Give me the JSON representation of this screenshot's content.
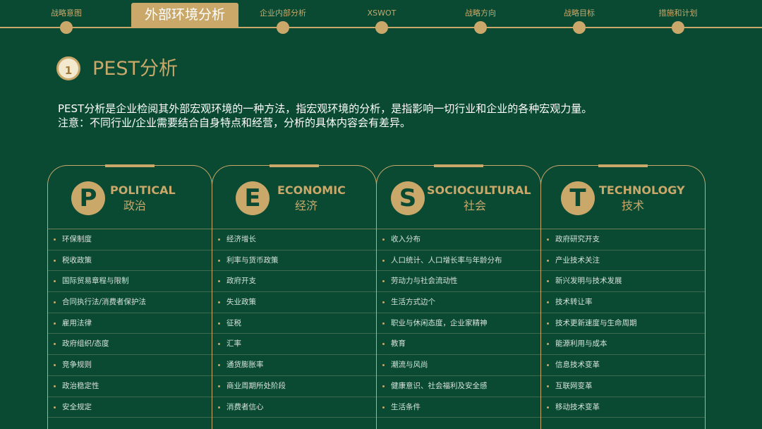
{
  "nav": {
    "items": [
      {
        "label": "战略意图",
        "active": false
      },
      {
        "label": "外部环境分析",
        "active": true
      },
      {
        "label": "企业内部分析",
        "active": false
      },
      {
        "label": "XSWOT",
        "active": false
      },
      {
        "label": "战略方向",
        "active": false
      },
      {
        "label": "战略目标",
        "active": false
      },
      {
        "label": "措施和计划",
        "active": false
      }
    ]
  },
  "section": {
    "number": "1",
    "title": "PEST分析"
  },
  "intro": {
    "line1": "PEST分析是企业检阅其外部宏观环境的一种方法，指宏观环境的分析，是指影响一切行业和企业的各种宏观力量。",
    "line2": "注意：不同行业/企业需要结合自身特点和经营，分析的具体内容会有差异。"
  },
  "cards": [
    {
      "letter": "P",
      "title_en": "POLITICAL",
      "title_zh": "政治",
      "items": [
        "环保制度",
        "税收政策",
        "国际贸易章程与限制",
        "合同执行法/消费者保护法",
        "雇用法律",
        "政府组织/态度",
        "竞争规则",
        "政治稳定性",
        "安全规定"
      ]
    },
    {
      "letter": "E",
      "title_en": "ECONOMIC",
      "title_zh": "经济",
      "items": [
        "经济增长",
        "利率与货币政策",
        "政府开支",
        "失业政策",
        "征税",
        "汇率",
        "通货膨胀率",
        "商业周期所处阶段",
        "消费者信心"
      ]
    },
    {
      "letter": "S",
      "title_en": "SOCIOCULTURAL",
      "title_zh": "社会",
      "items": [
        "收入分布",
        "人口统计、人口增长率与年龄分布",
        "劳动力与社会流动性",
        "生活方式边个",
        "职业与休闲态度，企业家精神",
        "教育",
        "潮流与风尚",
        "健康意识、社会福利及安全感",
        "生活条件"
      ]
    },
    {
      "letter": "T",
      "title_en": "TECHNOLOGY",
      "title_zh": "技术",
      "items": [
        "政府研究开支",
        "产业技术关注",
        "新兴发明与技术发展",
        "技术转让率",
        "技术更新速度与生命周期",
        "能源利用与成本",
        "信息技术变革",
        "互联网变革",
        "移动技术变革"
      ]
    }
  ],
  "colors": {
    "background": "#0a4a33",
    "accent": "#c9a86a"
  }
}
